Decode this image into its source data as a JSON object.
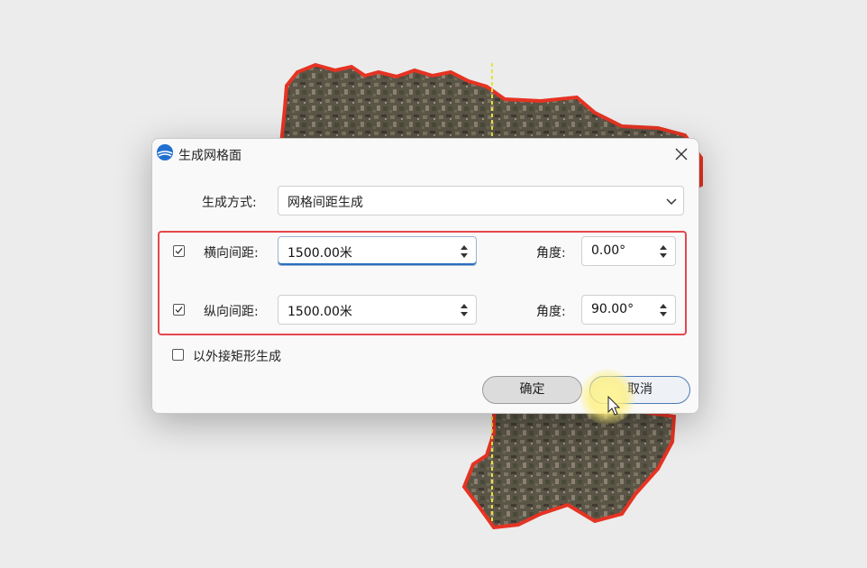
{
  "dialog": {
    "title": "生成网格面",
    "method_label": "生成方式:",
    "method_value": "网格间距生成",
    "horizontal": {
      "checked": true,
      "label": "横向间距:",
      "value": "1500.00米",
      "angle_label": "角度:",
      "angle_value": "0.00°"
    },
    "vertical": {
      "checked": true,
      "label": "纵向间距:",
      "value": "1500.00米",
      "angle_label": "角度:",
      "angle_value": "90.00°"
    },
    "bounding_rect": {
      "checked": false,
      "label": "以外接矩形生成"
    },
    "ok_label": "确定",
    "cancel_label": "取消"
  },
  "colors": {
    "highlight": "#e5484d",
    "map_outline": "#e53323",
    "grid_line": "#e8e23a",
    "accent": "#2a6fc1"
  },
  "icons": {
    "app": "globe-logo-icon",
    "close": "close-icon",
    "dropdown": "chevron-down-icon",
    "spinner": "spin-arrows-icon",
    "checkbox": "check-icon",
    "pointer": "mouse-pointer-icon"
  }
}
